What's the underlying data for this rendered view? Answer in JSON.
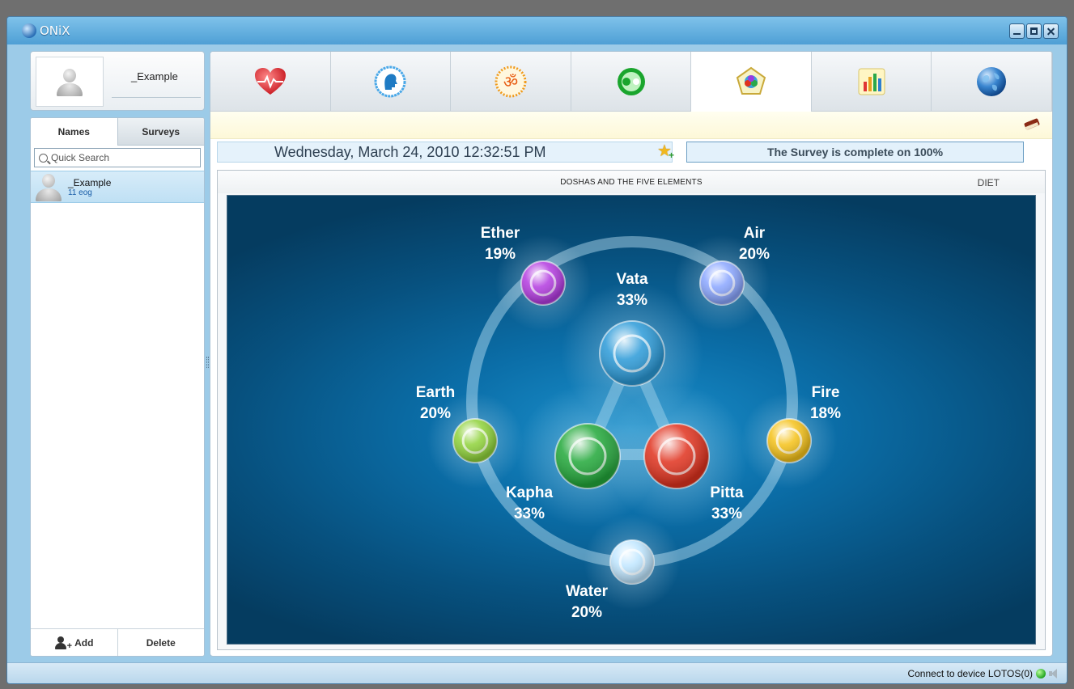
{
  "window": {
    "title": "ONiX"
  },
  "profile": {
    "name": "_Example"
  },
  "left_tabs": [
    {
      "label": "Names"
    },
    {
      "label": "Surveys"
    }
  ],
  "search": {
    "placeholder": "Quick Search"
  },
  "people": [
    {
      "name": "_Example",
      "sub": "11 eog"
    }
  ],
  "left_buttons": {
    "add": "Add",
    "delete": "Delete"
  },
  "top_tabs": [
    {
      "icon": "heart-icon"
    },
    {
      "icon": "head-profile-icon"
    },
    {
      "icon": "om-icon"
    },
    {
      "icon": "yin-yang-icon"
    },
    {
      "icon": "pentagon-elements-icon",
      "active": true
    },
    {
      "icon": "bar-chart-icon"
    },
    {
      "icon": "globe-icon"
    }
  ],
  "date_nav": {
    "datetime": "Wednesday, March 24, 2010 12:32:51 PM",
    "status": "The Survey is complete on 100%"
  },
  "chart": {
    "title": "DOSHAS AND THE FIVE ELEMENTS",
    "side_link": "DIET",
    "elements": [
      {
        "name": "Ether",
        "value": "19%",
        "color": "#b33be0"
      },
      {
        "name": "Air",
        "value": "20%",
        "color": "#8aa6ff"
      },
      {
        "name": "Fire",
        "value": "18%",
        "color": "#f5c21a"
      },
      {
        "name": "Water",
        "value": "20%",
        "color": "#bfe6ff"
      },
      {
        "name": "Earth",
        "value": "20%",
        "color": "#8fd23a"
      }
    ],
    "doshas": [
      {
        "name": "Vata",
        "value": "33%",
        "color": "#2b9ad8"
      },
      {
        "name": "Kapha",
        "value": "33%",
        "color": "#22a83a"
      },
      {
        "name": "Pitta",
        "value": "33%",
        "color": "#e0321e"
      }
    ]
  },
  "statusbar": {
    "text": "Connect to device LOTOS(0)"
  }
}
